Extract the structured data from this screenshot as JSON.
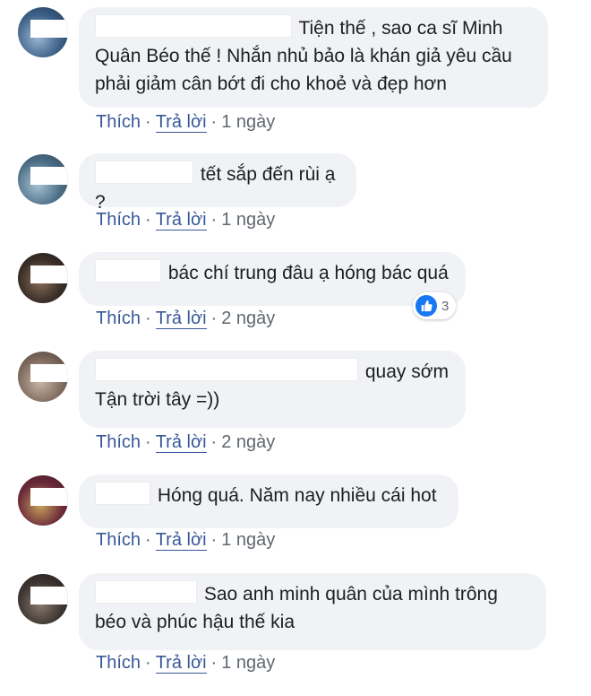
{
  "actions": {
    "like": "Thích",
    "reply": "Trả lời",
    "separator": "·"
  },
  "comments": [
    {
      "text": "Tiện thế , sao ca sĩ Minh Quân Béo thế ! Nhắn nhủ bảo là khán giả yêu cầu phải giảm cân bớt đi cho khoẻ và đẹp hơn",
      "time": "1 ngày",
      "avatar_colors": [
        "#3b5f86",
        "#9db7d3"
      ]
    },
    {
      "text": "tết sắp đến rùi ạ ?",
      "time": "1 ngày",
      "avatar_colors": [
        "#4b6e86",
        "#a9c4d4"
      ]
    },
    {
      "text": "bác chí trung đâu ạ hóng bác quá",
      "time": "2 ngày",
      "avatar_colors": [
        "#3a2f28",
        "#8c6e58"
      ],
      "reaction": {
        "icon": "thumbs-up-icon",
        "count": "3"
      }
    },
    {
      "text": "quay sớm Tận trời tây =))",
      "time": "2 ngày",
      "avatar_colors": [
        "#7f6a5e",
        "#c9b6a8"
      ]
    },
    {
      "text": "Hóng quá. Năm nay nhiều cái hot",
      "time": "1 ngày",
      "avatar_colors": [
        "#6b2a3b",
        "#c7a35a"
      ]
    },
    {
      "text": "Sao anh minh quân của mình trông béo và phúc hậu thế kia",
      "time": "1 ngày",
      "avatar_colors": [
        "#3c3430",
        "#8a7a6e"
      ]
    }
  ],
  "colors": {
    "bubble": "#f0f2f5",
    "link": "#385898",
    "like_blue": "#1877f2"
  }
}
